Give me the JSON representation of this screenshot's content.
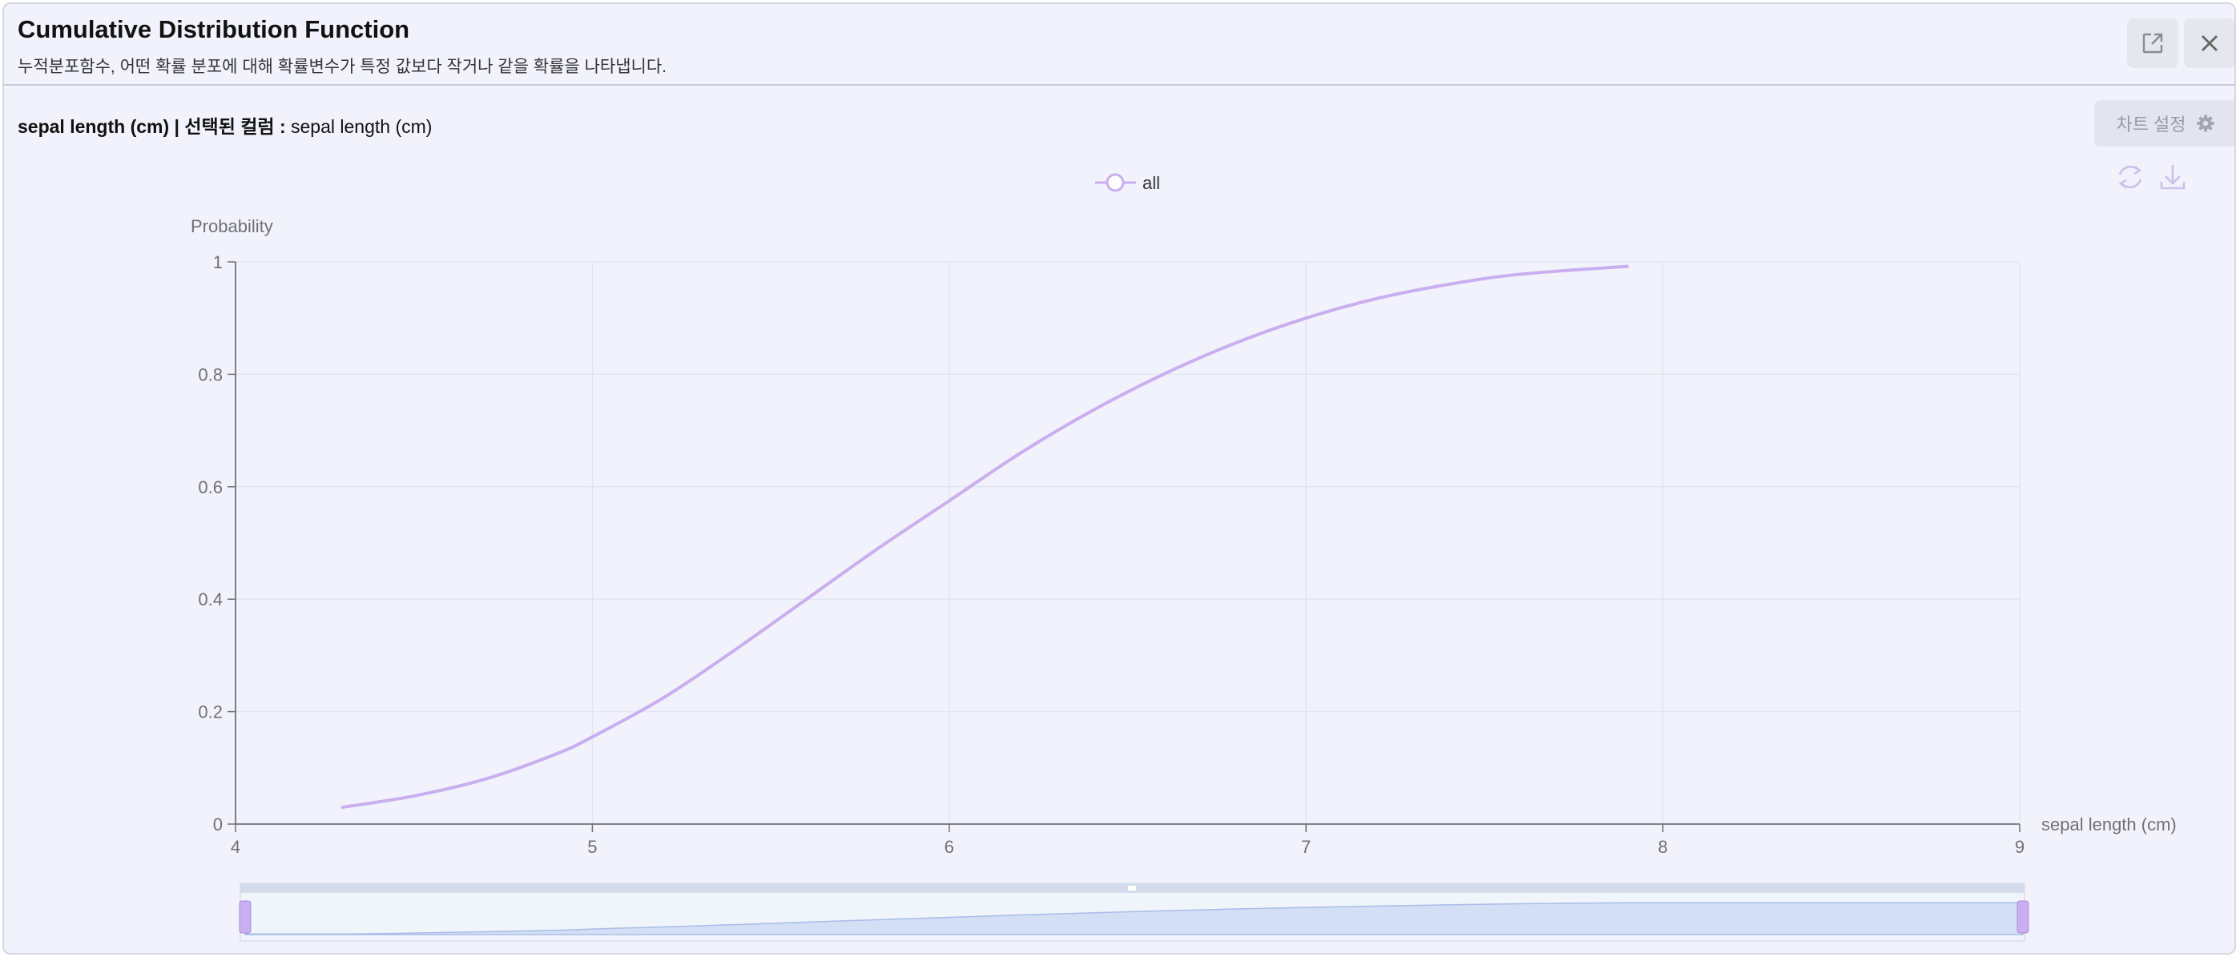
{
  "header": {
    "title": "Cumulative Distribution Function",
    "subtitle": "누적분포함수, 어떤 확률 분포에 대해 확률변수가 특정 값보다 작거나 같을 확률을 나타냅니다.",
    "open_icon": "external-link-icon",
    "close_icon": "close-icon"
  },
  "column_info": {
    "column_name": "sepal length (cm)",
    "separator": "|",
    "selected_label": "선택된 컬럼 :",
    "selected_value": "sepal length (cm)"
  },
  "toolbar": {
    "settings_label": "차트 설정",
    "settings_icon": "gear-icon",
    "refresh_icon": "refresh-icon",
    "download_icon": "download-icon"
  },
  "chart_data": {
    "type": "line",
    "xlabel": "sepal length (cm)",
    "ylabel": "Probability",
    "xlim": [
      4,
      9
    ],
    "ylim": [
      0,
      1
    ],
    "x_ticks": [
      "4",
      "5",
      "6",
      "7",
      "8",
      "9"
    ],
    "y_ticks": [
      "0",
      "0.2",
      "0.4",
      "0.6",
      "0.8",
      "1"
    ],
    "grid": true,
    "legend_position": "top-center",
    "series": [
      {
        "name": "all",
        "color": "#c9aef0",
        "x": [
          4.3,
          4.5,
          4.7,
          4.9,
          5.0,
          5.2,
          5.4,
          5.6,
          5.8,
          6.0,
          6.2,
          6.4,
          6.6,
          6.8,
          7.0,
          7.2,
          7.4,
          7.6,
          7.9
        ],
        "y": [
          0.03,
          0.05,
          0.08,
          0.125,
          0.155,
          0.225,
          0.31,
          0.4,
          0.49,
          0.575,
          0.66,
          0.735,
          0.8,
          0.855,
          0.9,
          0.935,
          0.96,
          0.978,
          0.992
        ]
      }
    ],
    "datazoom": {
      "start": 0,
      "end": 100
    }
  },
  "colors": {
    "line": "#c9aef0",
    "axis": "#6e7079",
    "grid": "#e0e6f1",
    "zoom_fill": "#d3dff5",
    "zoom_handle": "#c9aef0"
  }
}
